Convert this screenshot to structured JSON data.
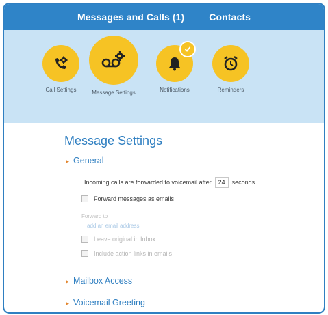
{
  "topbar": {
    "tabs": [
      {
        "label": "Messages and Calls (1)"
      },
      {
        "label": "Contacts"
      }
    ]
  },
  "iconbar": {
    "items": [
      {
        "label": "Call Settings",
        "icon": "phone-gear-icon"
      },
      {
        "label": "Message Settings",
        "icon": "voicemail-gear-icon",
        "active": true
      },
      {
        "label": "Notifications",
        "icon": "bell-icon"
      },
      {
        "label": "Reminders",
        "icon": "alarm-clock-icon"
      }
    ]
  },
  "main": {
    "title": "Message Settings",
    "sections": {
      "general": "General",
      "mailbox": "Mailbox Access",
      "greeting": "Voicemail Greeting"
    },
    "forward_prefix": "Incoming calls are forwarded to voicemail after",
    "forward_seconds": "24",
    "forward_suffix": "seconds",
    "forward_emails_label": "Forward messages as emails",
    "forward_to_label": "Forward to",
    "email_placeholder": "add an email address",
    "leave_original_label": "Leave original in Inbox",
    "include_action_label": "Include action links in emails"
  },
  "colors": {
    "brand_blue": "#2f84c8",
    "icon_bar_bg": "#c9e3f5",
    "icon_yellow": "#f6c324",
    "section_accent": "#e3862f"
  }
}
